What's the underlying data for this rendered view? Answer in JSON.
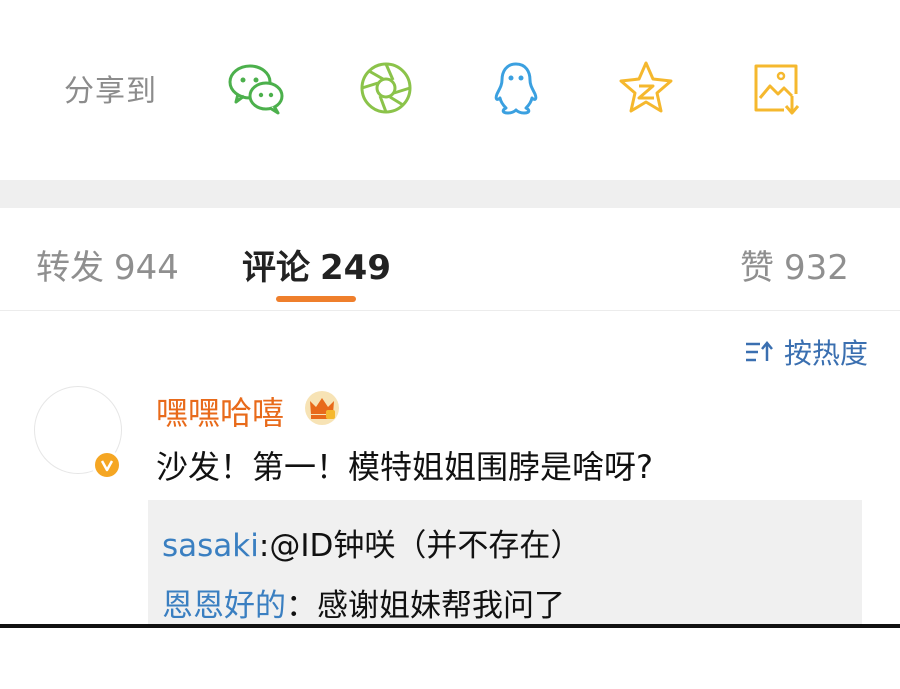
{
  "share": {
    "label": "分享到",
    "targets": [
      "wechat-icon",
      "moments-icon",
      "qq-icon",
      "qzone-icon",
      "save-image-icon"
    ]
  },
  "tabs": [
    {
      "label": "转发",
      "count": "944",
      "active": false
    },
    {
      "label": "评论",
      "count": "249",
      "active": true
    },
    {
      "label": "赞",
      "count": "932",
      "active": false
    }
  ],
  "sort": {
    "label": "按热度"
  },
  "comment": {
    "username": "嘿嘿哈嘻",
    "text": "沙发！第一！模特姐姐围脖是啥呀?",
    "replies": [
      {
        "author": "sasaki",
        "sep": ":",
        "text": "@ID钟咲（并不存在）"
      },
      {
        "author": "恩恩好的",
        "sep": "：",
        "text": "感谢姐妹帮我问了"
      }
    ]
  },
  "colors": {
    "accent_orange": "#ef7f2c",
    "link_blue": "#3a7fc1",
    "wechat_green": "#4cb04c",
    "moments_green": "#8bc34a",
    "qq_blue": "#3ba0e0",
    "qzone_yellow": "#f5b82e"
  }
}
